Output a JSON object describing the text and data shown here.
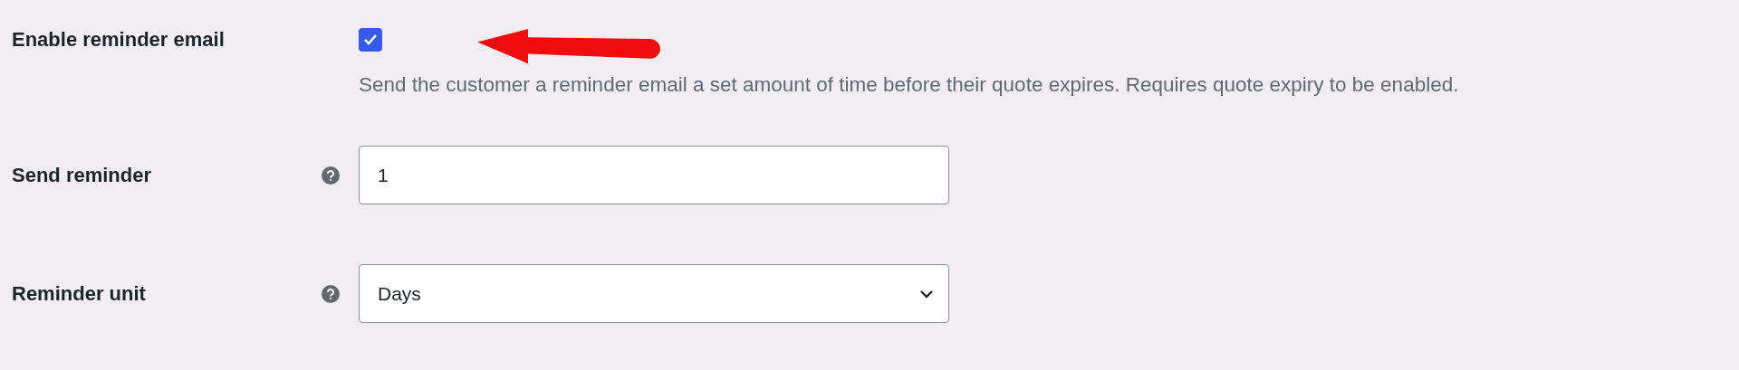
{
  "settings": [
    {
      "kind": "checkbox",
      "label": "Enable reminder email",
      "checked": true,
      "help_icon": false,
      "description": "Send the customer a reminder email a set amount of time before their quote expires. Requires quote expiry to be enabled."
    },
    {
      "kind": "text",
      "label": "Send reminder",
      "help_icon": true,
      "value": "1"
    },
    {
      "kind": "select",
      "label": "Reminder unit",
      "help_icon": true,
      "value": "Days"
    }
  ]
}
